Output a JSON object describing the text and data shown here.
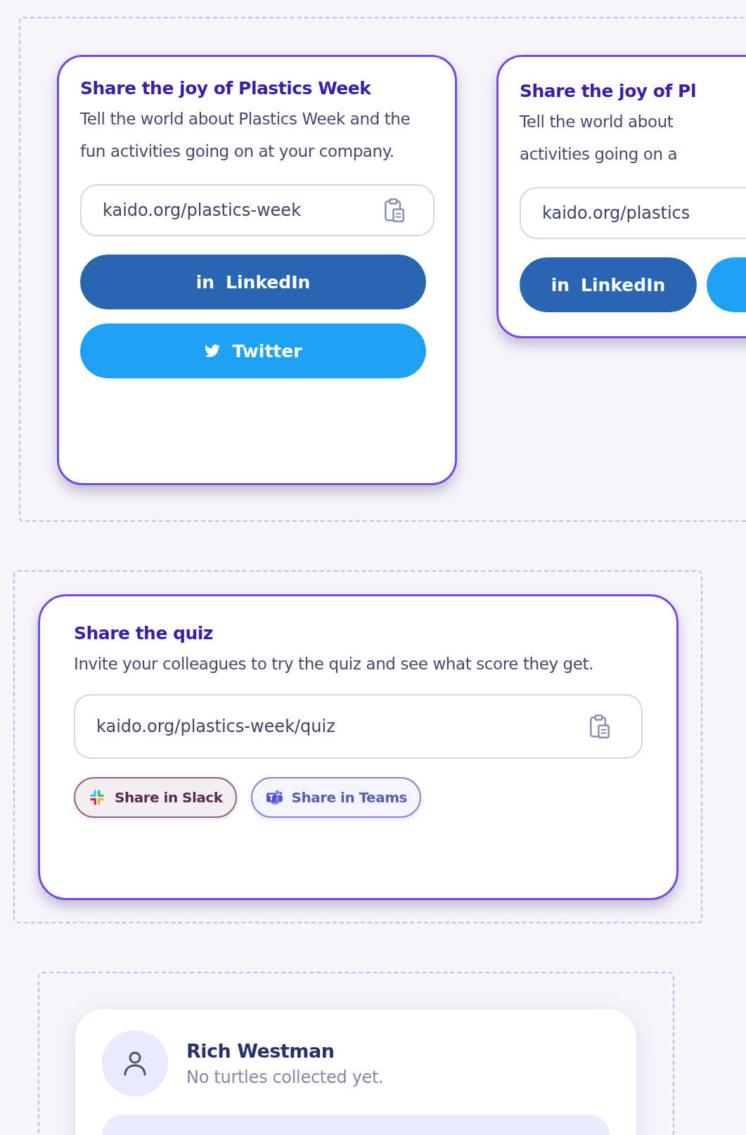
{
  "share_cards": [
    {
      "title": "Share the joy of Plastics Week",
      "description_lines": [
        "Tell the world about Plastics Week and the fun activities going on at your company."
      ],
      "link": "kaido.org/plastics-week",
      "buttons": [
        {
          "kind": "linkedin",
          "icon_text": "in",
          "label": "LinkedIn"
        },
        {
          "kind": "twitter",
          "label": "Twitter"
        }
      ]
    },
    {
      "title": "Share the joy of Pl",
      "description_lines": [
        "Tell the world about",
        "activities going on a"
      ],
      "link": "kaido.org/plastics",
      "buttons": [
        {
          "kind": "linkedin",
          "icon_text": "in",
          "label": "LinkedIn"
        },
        {
          "kind": "twitter"
        }
      ]
    }
  ],
  "quiz_card": {
    "title": "Share the quiz",
    "description": "Invite your colleagues to try the quiz and see what score they get.",
    "link": "kaido.org/plastics-week/quiz",
    "buttons": [
      {
        "kind": "slack",
        "label": "Share in Slack"
      },
      {
        "kind": "teams",
        "label": "Share in Teams"
      }
    ]
  },
  "profile_card": {
    "name": "Rich Westman",
    "status": "No turtles collected yet."
  }
}
